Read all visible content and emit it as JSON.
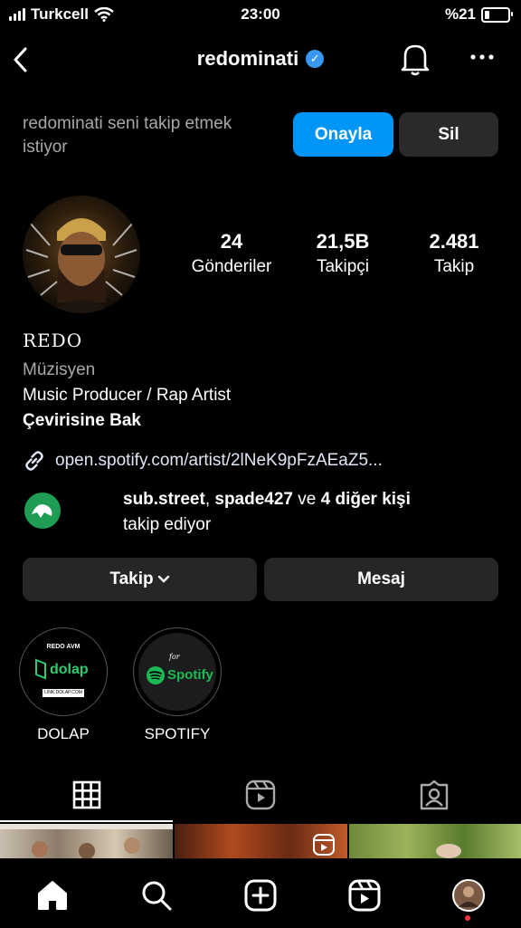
{
  "status_bar": {
    "carrier": "Turkcell",
    "time": "23:00",
    "battery": "%21",
    "battery_level": 0.21
  },
  "header": {
    "username": "redominati"
  },
  "follow_request": {
    "text": "redominati seni takip etmek istiyor",
    "approve_label": "Onayla",
    "delete_label": "Sil"
  },
  "stats": [
    {
      "value": "24",
      "label": "Gönderiler"
    },
    {
      "value": "21,5B",
      "label": "Takipçi"
    },
    {
      "value": "2.481",
      "label": "Takip"
    }
  ],
  "profile": {
    "name": "REDO",
    "category": "Müzisyen",
    "bio": "Music Producer / Rap Artist",
    "translate": "Çevirisine Bak",
    "link": "open.spotify.com/artist/2lNeK9pFzAEaZ5..."
  },
  "followed_by": {
    "user1": "sub.street",
    "sep1": ", ",
    "user2": "spade427",
    "sep2": " ve ",
    "others": "4 diğer kişi",
    "suffix": "takip ediyor"
  },
  "actions": {
    "follow_label": "Takip",
    "message_label": "Mesaj"
  },
  "highlights": [
    {
      "label": "DOLAP",
      "top_text": "REDO AVM",
      "logo_text": "dolap",
      "sub_text": "LINK.DOLAP.COM"
    },
    {
      "label": "SPOTIFY",
      "logo_text": "Spotify",
      "script_text": "for"
    }
  ],
  "icons": [
    "back-icon",
    "verified-badge-icon",
    "bell-icon",
    "more-icon",
    "link-icon",
    "chevron-down-icon",
    "grid-icon",
    "reels-icon",
    "tagged-icon",
    "home-icon",
    "search-icon",
    "create-icon",
    "reels-nav-icon",
    "profile-avatar-icon"
  ],
  "colors": {
    "accent": "#0095f6",
    "button_bg": "#262628",
    "secondary_text": "#a8a8a8",
    "notification_dot": "#ff3040"
  }
}
